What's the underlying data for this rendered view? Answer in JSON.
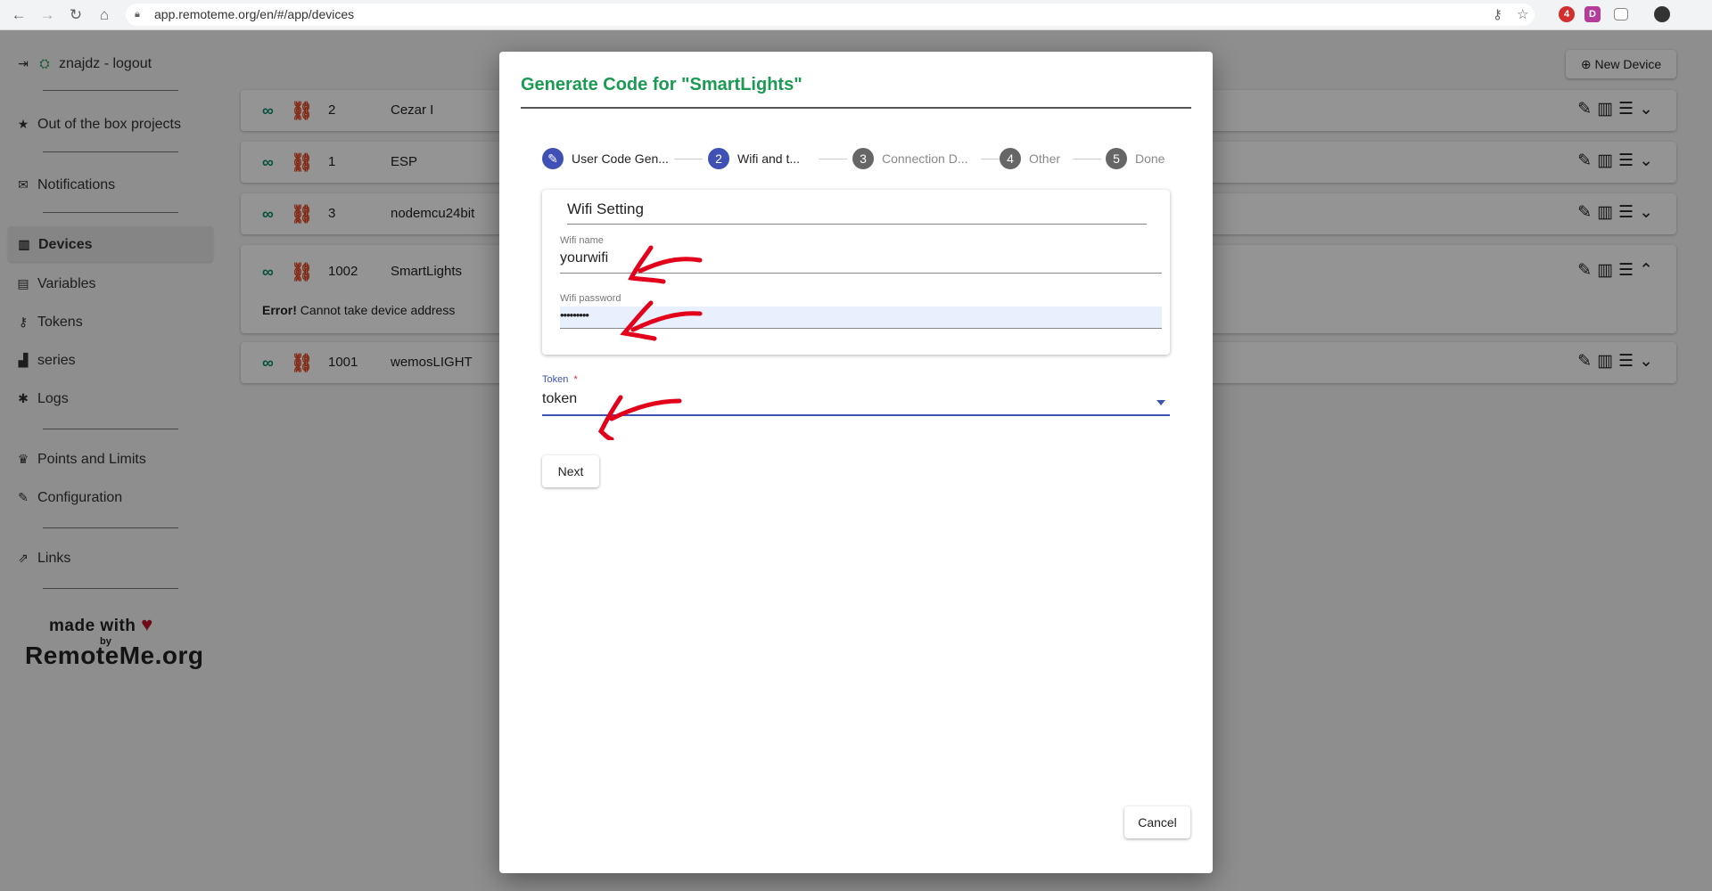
{
  "browser": {
    "url": "app.remoteme.org/en/#/app/devices",
    "ext_badge": "4",
    "ext_d": "D"
  },
  "sidebar": {
    "user_label": "znajdz - logout",
    "items": [
      {
        "label": "Out of the box projects",
        "icon": "star-icon"
      },
      {
        "label": "Notifications",
        "icon": "envelope-icon"
      },
      {
        "label": "Devices",
        "icon": "chip-icon"
      },
      {
        "label": "Variables",
        "icon": "file-x-icon"
      },
      {
        "label": "Tokens",
        "icon": "key-icon"
      },
      {
        "label": "series",
        "icon": "chart-icon"
      },
      {
        "label": "Logs",
        "icon": "bug-icon"
      },
      {
        "label": "Points and Limits",
        "icon": "trophy-icon"
      },
      {
        "label": "Configuration",
        "icon": "wrench-icon"
      },
      {
        "label": "Links",
        "icon": "external-link-icon"
      }
    ],
    "made_with": "made with",
    "by": "by",
    "brand": "RemoteMe.org"
  },
  "toolbar": {
    "new_device": "New Device"
  },
  "devices": [
    {
      "id": "2",
      "name": "Cezar I"
    },
    {
      "id": "1",
      "name": "ESP"
    },
    {
      "id": "3",
      "name": "nodemcu24bit"
    },
    {
      "id": "1002",
      "name": "SmartLights",
      "error_prefix": "Error!",
      "error_text": "Cannot take device address"
    },
    {
      "id": "1001",
      "name": "wemosLIGHT"
    }
  ],
  "dialog": {
    "title": "Generate Code for \"SmartLights\"",
    "steps": [
      {
        "num": "",
        "label": "User Code Gen..."
      },
      {
        "num": "2",
        "label": "Wifi and t..."
      },
      {
        "num": "3",
        "label": "Connection D..."
      },
      {
        "num": "4",
        "label": "Other"
      },
      {
        "num": "5",
        "label": "Done"
      }
    ],
    "wifi_card_title": "Wifi Setting",
    "wifi_name_label": "Wifi name",
    "wifi_name_value": "yourwifi",
    "wifi_password_label": "Wifi password",
    "wifi_password_value": "•••••••••",
    "token_label": "Token",
    "token_required": "*",
    "token_value": "token",
    "next_button": "Next",
    "cancel_button": "Cancel"
  },
  "colors": {
    "accent": "#3f51b5",
    "title_green": "#1a9a52",
    "annotation_red": "#e3001b"
  }
}
